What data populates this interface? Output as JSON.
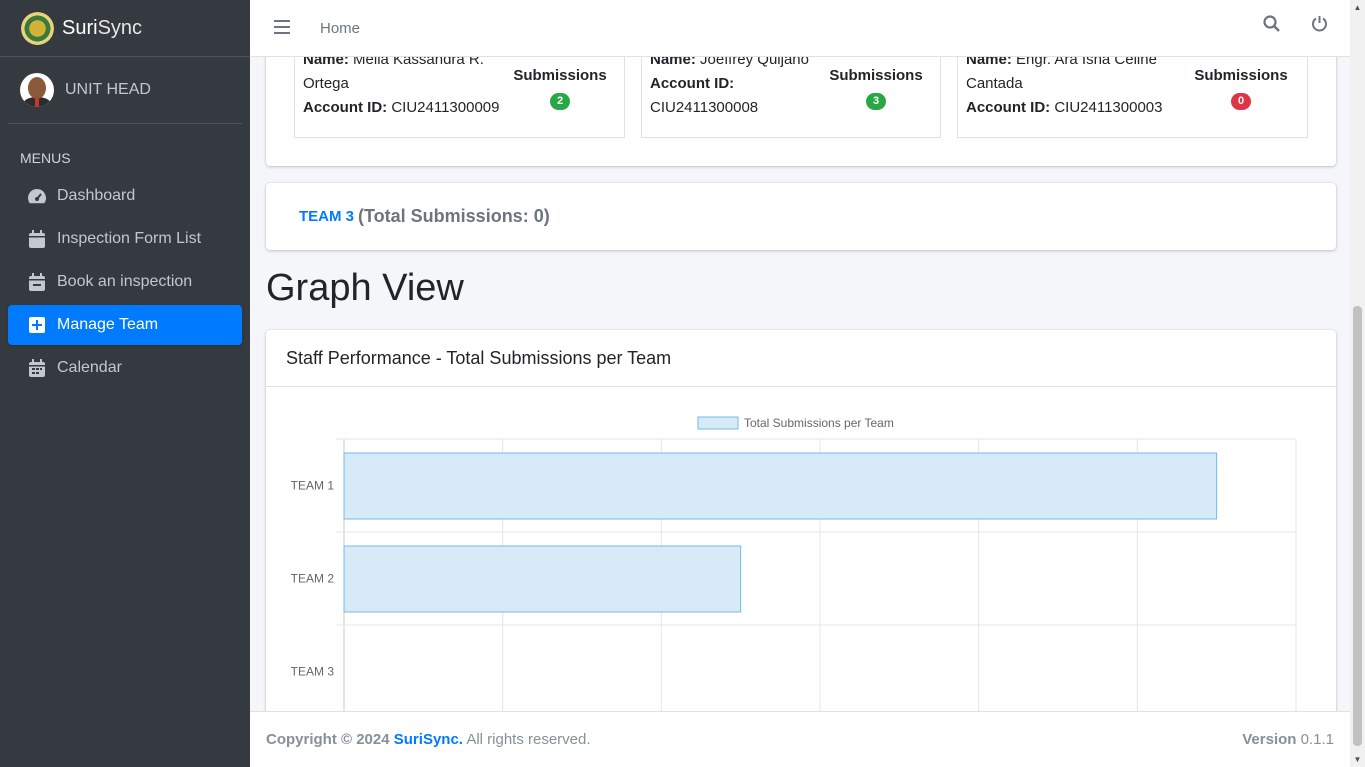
{
  "brand": {
    "name_part1": "Suri",
    "name_part2": "Sync"
  },
  "user": {
    "role": "UNIT HEAD"
  },
  "sidebar": {
    "header": "MENUS",
    "items": [
      {
        "label": "Dashboard",
        "icon": "gauge-icon"
      },
      {
        "label": "Inspection Form List",
        "icon": "calendar-icon"
      },
      {
        "label": "Book an inspection",
        "icon": "calendar-minus-icon"
      },
      {
        "label": "Manage Team",
        "icon": "plus-square-icon"
      },
      {
        "label": "Calendar",
        "icon": "calendar-days-icon"
      }
    ]
  },
  "topnav": {
    "home": "Home"
  },
  "members": [
    {
      "name_label": "Name:",
      "name": "Mella Kassandra R. Ortega",
      "account_label": "Account ID:",
      "account_id": "CIU2411300009",
      "total_label": "Total Submissions",
      "total": "2",
      "badge_color": "#28a745"
    },
    {
      "name_label": "Name:",
      "name": "Joeffrey Quijano",
      "account_label": "Account ID:",
      "account_id": "CIU2411300008",
      "total_label": "Total Submissions",
      "total": "3",
      "badge_color": "#28a745"
    },
    {
      "name_label": "Name:",
      "name": "Engr. Ara Isha Celine Cantada",
      "account_label": "Account ID:",
      "account_id": "CIU2411300003",
      "total_label": "Total Submissions",
      "total": "0",
      "badge_color": "#dc3545"
    }
  ],
  "team3": {
    "link": "TEAM 3",
    "summary": "(Total Submissions: 0)"
  },
  "graph": {
    "section_title": "Graph View",
    "card_title": "Staff Performance - Total Submissions per Team"
  },
  "chart_data": {
    "type": "bar",
    "orientation": "horizontal",
    "categories": [
      "TEAM 1",
      "TEAM 2",
      "TEAM 3"
    ],
    "series": [
      {
        "name": "Total Submissions per Team",
        "values": [
          5.5,
          2.5,
          0
        ]
      }
    ],
    "xlim": [
      0,
      6
    ],
    "grid": true,
    "legend": "top",
    "colors": {
      "fill": "#d6eaf8",
      "stroke": "#74b9e8"
    }
  },
  "footer": {
    "copyright": "Copyright © 2024",
    "brand": "SuriSync.",
    "rights": "All rights reserved.",
    "version_label": "Version",
    "version": "0.1.1"
  }
}
